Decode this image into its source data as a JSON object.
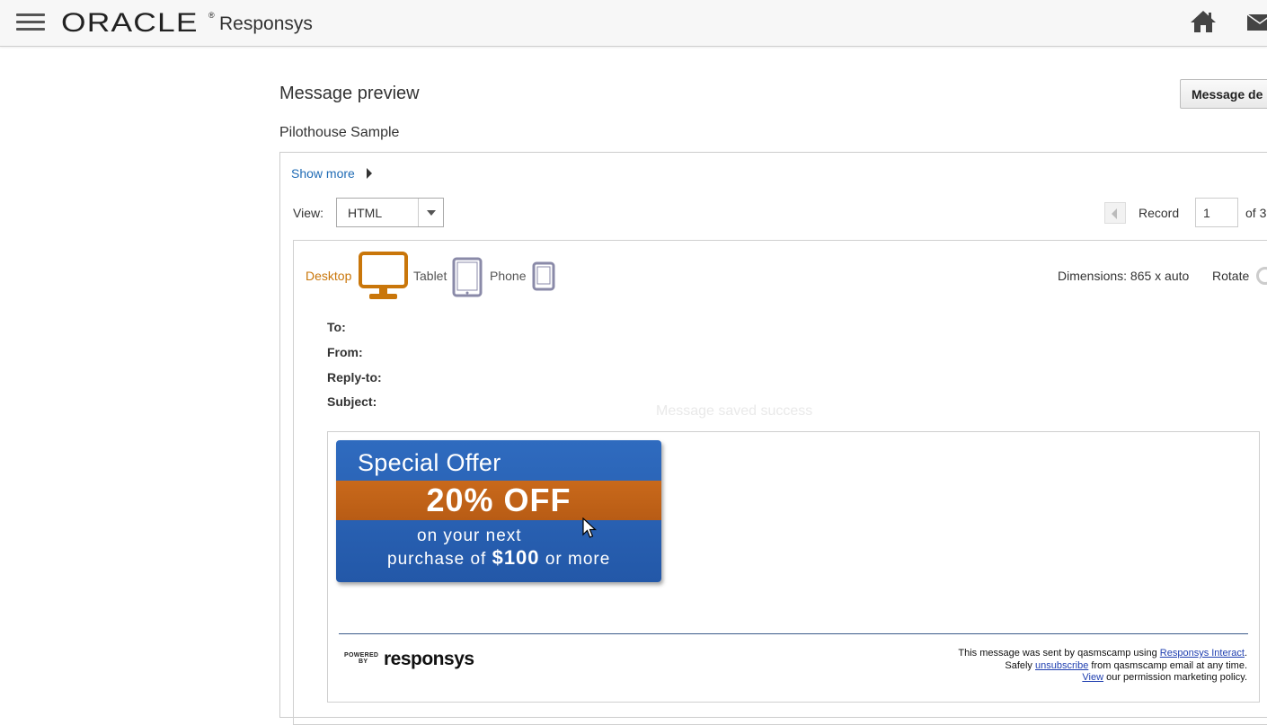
{
  "app": {
    "logo_text": "ORACLE",
    "logo_mark": "®",
    "product_name": "Responsys",
    "icons": [
      "hamburger-menu-icon",
      "home-icon",
      "mail-icon"
    ]
  },
  "page": {
    "title": "Message preview",
    "message_details_button": "Message de",
    "subtitle": "Pilothouse Sample"
  },
  "controls": {
    "show_more": "Show more",
    "view_label": "View:",
    "view_value": "HTML",
    "record_label": "Record",
    "record_value": "1",
    "of_label": "of 3"
  },
  "devices": {
    "desktop": "Desktop",
    "tablet": "Tablet",
    "phone": "Phone",
    "selected": "Desktop",
    "active_color": "#c9760a",
    "inactive_color": "#8a8aa8",
    "dimensions": "Dimensions: 865 x auto",
    "rotate": "Rotate"
  },
  "headers": {
    "to": "To:",
    "from": "From:",
    "reply_to": "Reply-to:",
    "subject": "Subject:"
  },
  "toast_ghost": "Message saved success",
  "banner": {
    "title": "Special Offer",
    "big": "20% OFF",
    "line1": "on your next",
    "line2_pre": "purchase of",
    "line2_amount": "$100",
    "line2_post": "or more",
    "blue": "#2a63b5",
    "orange": "#c0641a"
  },
  "footer": {
    "powered_small_1": "POWERED",
    "powered_small_2": "BY",
    "powered_brand": "responsys",
    "line1_pre": "This message was sent by qasmscamp using ",
    "line1_link": "Responsys Interact",
    "line1_post": ".",
    "line2_pre": "Safely ",
    "line2_link": "unsubscribe",
    "line2_post": " from qasmscamp email at any time.",
    "line3_link": "View",
    "line3_post": " our permission marketing policy."
  }
}
